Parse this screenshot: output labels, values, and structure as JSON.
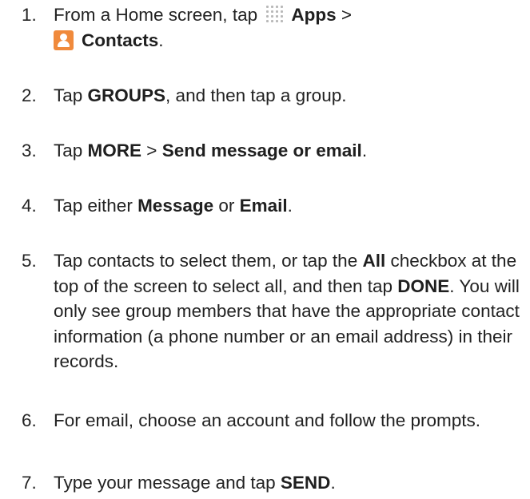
{
  "steps": [
    {
      "num": "1.",
      "line1_pre": "From a Home screen, tap ",
      "apps": "Apps",
      "sep": " >",
      "contacts": "Contacts",
      "period": "."
    },
    {
      "num": "2.",
      "pre": "Tap ",
      "groups": "GROUPS",
      "post": ", and then tap a group."
    },
    {
      "num": "3.",
      "pre": "Tap ",
      "more": "MORE",
      "sep": " > ",
      "send": "Send message or email",
      "period": "."
    },
    {
      "num": "4.",
      "pre": "Tap either ",
      "message": "Message",
      "mid": " or ",
      "email": "Email",
      "period": "."
    },
    {
      "num": "5.",
      "pre": "Tap contacts to select them, or tap the ",
      "all": "All",
      "mid": " checkbox at the top of the screen to select all, and then tap ",
      "done": "DONE",
      "post": ". You will only see group members that have the appropriate contact information (a phone number or an email address) in their records."
    },
    {
      "num": "6.",
      "text": "For email, choose an account and follow the prompts."
    },
    {
      "num": "7.",
      "pre": "Type your message and tap ",
      "sendbtn": "SEND",
      "period": "."
    }
  ],
  "icons": {
    "apps": "apps-grid-icon",
    "contacts": "contacts-icon",
    "contacts_color": "#f08a3c"
  }
}
